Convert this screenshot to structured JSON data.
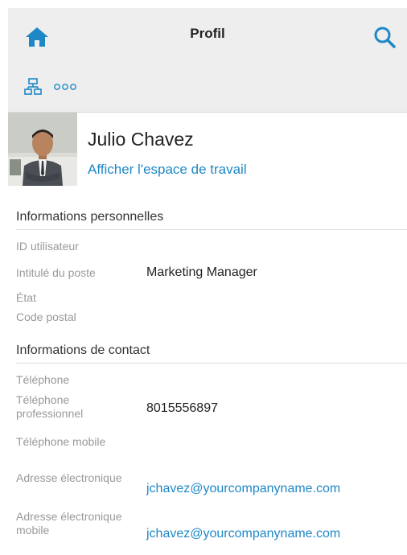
{
  "header": {
    "title": "Profil",
    "home_icon": "home-icon",
    "search_icon": "search-icon"
  },
  "toolbar": {
    "org_icon": "org-chart-icon",
    "more_icon": "more-options-icon"
  },
  "profile": {
    "name": "Julio Chavez",
    "workspace_link": "Afficher l'espace de travail"
  },
  "personal_info": {
    "heading": "Informations personnelles",
    "fields": [
      {
        "label": "ID utilisateur",
        "value": ""
      },
      {
        "label": "Intitulé du poste",
        "value": "Marketing Manager"
      },
      {
        "label": "État",
        "value": ""
      },
      {
        "label": "Code postal",
        "value": ""
      }
    ]
  },
  "contact_info": {
    "heading": "Informations de contact",
    "fields": [
      {
        "label": "Téléphone",
        "value": ""
      },
      {
        "label": "Téléphone professionnel",
        "value": "8015556897"
      },
      {
        "label": "Téléphone mobile",
        "value": ""
      },
      {
        "label": "Adresse électronique",
        "value": "jchavez@yourcompanyname.com"
      },
      {
        "label": "Adresse électronique mobile",
        "value": "jchavez@yourcompanyname.com"
      }
    ]
  },
  "colors": {
    "accent": "#1e88c7",
    "header_bg": "#eeeeee",
    "label_gray": "#999999"
  }
}
